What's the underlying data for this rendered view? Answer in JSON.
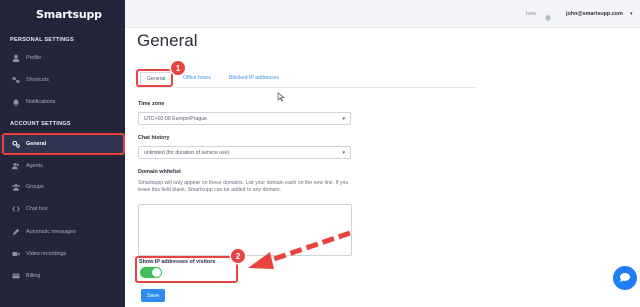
{
  "app": {
    "logo": "Smartsupp"
  },
  "sidebar": {
    "personal_heading": "PERSONAL SETTINGS",
    "account_heading": "ACCOUNT SETTINGS",
    "personal_items": [
      {
        "label": "Profile",
        "icon": "user-icon"
      },
      {
        "label": "Shortcuts",
        "icon": "shortcut-icon"
      },
      {
        "label": "Notifications",
        "icon": "bell-icon"
      }
    ],
    "account_items": [
      {
        "label": "General",
        "icon": "gears-icon",
        "active": true
      },
      {
        "label": "Agents",
        "icon": "users-icon"
      },
      {
        "label": "Groups",
        "icon": "group-icon"
      },
      {
        "label": "Chat box",
        "icon": "code-icon"
      },
      {
        "label": "Automatic messages",
        "icon": "pencil-icon"
      },
      {
        "label": "Video recordings",
        "icon": "video-icon"
      },
      {
        "label": "Billing",
        "icon": "card-icon"
      }
    ]
  },
  "topbar": {
    "beta": "beta",
    "email": "john@smartsupp.com"
  },
  "main": {
    "title": "General",
    "tabs": [
      {
        "label": "General",
        "active": true
      },
      {
        "label": "Office hours"
      },
      {
        "label": "Blocked IP addresses"
      }
    ],
    "timezone": {
      "label": "Time zone",
      "value": "UTC+02:00 Europe/Prague"
    },
    "chat_history": {
      "label": "Chat history",
      "value": "unlimited (for duration of service use)"
    },
    "domain_whitelist": {
      "label": "Domain whitelist",
      "help": "Smartsupp will only appear on these domains. List your domain each on the new line. If you leave this field blank, Smartsupp can be added to any domain."
    },
    "show_ip": {
      "label": "Show IP addresses of visitors",
      "enabled": true
    },
    "save_label": "Save"
  },
  "annotations": {
    "badge_1": "1",
    "badge_2": "2"
  },
  "colors": {
    "sidebar": "#23263a",
    "accent": "#2e8cf0",
    "highlight": "#e8433f",
    "toggle_on": "#3fbf5a"
  }
}
